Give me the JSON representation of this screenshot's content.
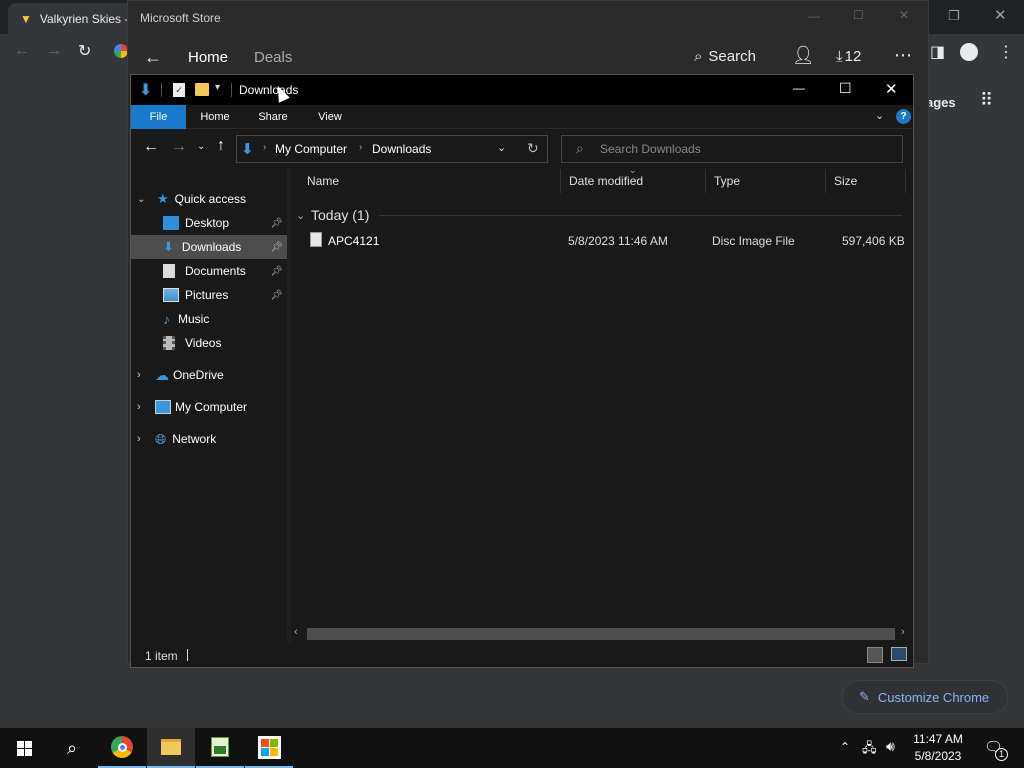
{
  "chrome": {
    "tab_title": "Valkyrien Skies -",
    "page_partial_text": "ages",
    "customize_label": "Customize Chrome"
  },
  "store": {
    "title": "Microsoft Store",
    "nav_home": "Home",
    "nav_deals": "Deals",
    "search_label": "Search",
    "downloads_count": "12"
  },
  "explorer": {
    "title": "Downloads",
    "ribbon_tabs": [
      "File",
      "Home",
      "Share",
      "View"
    ],
    "address": {
      "crumbs": [
        "My Computer",
        "Downloads"
      ]
    },
    "search_placeholder": "Search Downloads",
    "nav": {
      "quick_access": "Quick access",
      "items": [
        {
          "label": "Desktop",
          "icon": "desktop-icon",
          "pinned": true
        },
        {
          "label": "Downloads",
          "icon": "downloads-icon",
          "pinned": true,
          "selected": true
        },
        {
          "label": "Documents",
          "icon": "documents-icon",
          "pinned": true
        },
        {
          "label": "Pictures",
          "icon": "pictures-icon",
          "pinned": true
        },
        {
          "label": "Music",
          "icon": "music-icon",
          "pinned": false
        },
        {
          "label": "Videos",
          "icon": "videos-icon",
          "pinned": false
        }
      ],
      "onedrive": "OneDrive",
      "my_computer": "My Computer",
      "network": "Network"
    },
    "columns": [
      "Name",
      "Date modified",
      "Type",
      "Size"
    ],
    "group_label": "Today (1)",
    "files": [
      {
        "name": "APC4121",
        "date": "5/8/2023 11:46 AM",
        "type": "Disc Image File",
        "size": "597,406 KB"
      }
    ],
    "status": "1 item"
  },
  "taskbar": {
    "time": "11:47 AM",
    "date": "5/8/2023",
    "notification_count": "1"
  },
  "colors": {
    "ribbon_file_bg": "#1979ca",
    "accent_blue": "#8ab4f8",
    "selected_row": "#4d4d4d",
    "taskbar_bg": "#101010"
  }
}
